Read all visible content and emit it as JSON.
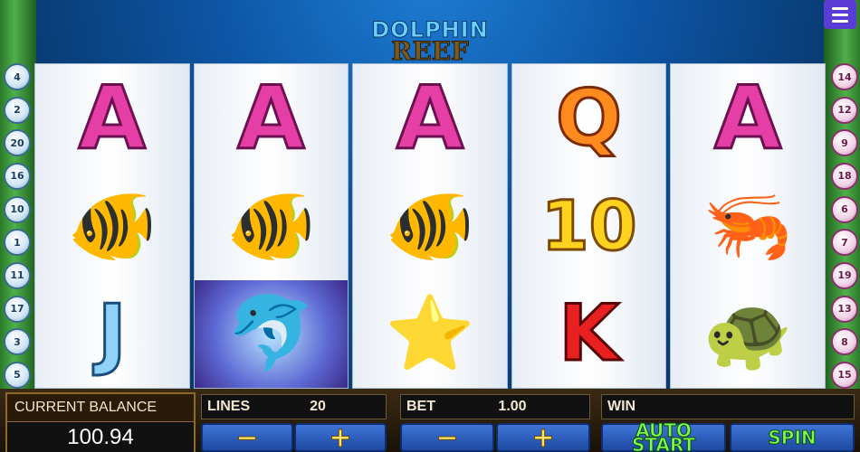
{
  "logo": {
    "line1": "DOLPHIN",
    "line2": "REEF"
  },
  "menu": {
    "icon": "hamburger-menu-icon"
  },
  "paylines_left": [
    "4",
    "2",
    "20",
    "16",
    "10",
    "1",
    "11",
    "17",
    "3",
    "5"
  ],
  "paylines_right": [
    "14",
    "12",
    "9",
    "18",
    "6",
    "7",
    "19",
    "13",
    "8",
    "15"
  ],
  "reels": [
    [
      {
        "kind": "A",
        "label": "A"
      },
      {
        "kind": "pic",
        "label": "🐠",
        "name": "clownfish"
      },
      {
        "kind": "J",
        "label": "J"
      }
    ],
    [
      {
        "kind": "A",
        "label": "A"
      },
      {
        "kind": "pic",
        "label": "🐠",
        "name": "clownfish"
      },
      {
        "kind": "pic",
        "label": "🐬",
        "name": "dolphin",
        "bg": "dolphin"
      }
    ],
    [
      {
        "kind": "A",
        "label": "A"
      },
      {
        "kind": "pic",
        "label": "🐠",
        "name": "clownfish"
      },
      {
        "kind": "pic",
        "label": "⭐",
        "name": "starfish"
      }
    ],
    [
      {
        "kind": "Q",
        "label": "Q"
      },
      {
        "kind": "10",
        "label": "10"
      },
      {
        "kind": "K",
        "label": "K"
      }
    ],
    [
      {
        "kind": "A",
        "label": "A"
      },
      {
        "kind": "pic",
        "label": "🦐",
        "name": "seahorse"
      },
      {
        "kind": "pic",
        "label": "🐢",
        "name": "turtle"
      }
    ]
  ],
  "balance": {
    "label": "CURRENT BALANCE",
    "value": "100.94"
  },
  "lines": {
    "label": "LINES",
    "value": "20"
  },
  "bet": {
    "label": "BET",
    "value": "1.00"
  },
  "win": {
    "label": "WIN",
    "value": ""
  },
  "buttons": {
    "minus": "−",
    "plus": "+",
    "auto_start": "AUTO START",
    "spin": "SPIN"
  }
}
